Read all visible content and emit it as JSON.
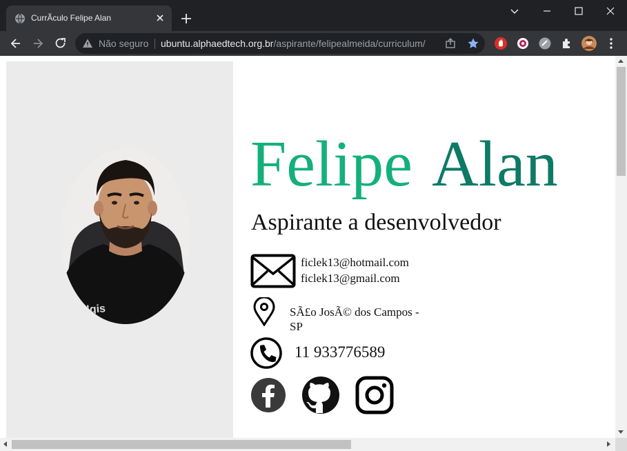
{
  "browser": {
    "tab_title": "CurrÃculo Felipe Alan",
    "security_label": "Não seguro",
    "url_host": "ubuntu.alphaedtech.org.br",
    "url_path": "/aspirante/felipealmeida/curriculum/"
  },
  "profile": {
    "first_name": "Felipe",
    "last_name": "Alan",
    "subtitle": "Aspirante a desenvolvedor",
    "email_1": "ficlek13@hotmail.com",
    "email_2": "ficlek13@gmail.com",
    "location": "SÃ£o JosÃ© dos Campos - SP",
    "phone": "11 933776589"
  },
  "colors": {
    "first_name": "#14b07c",
    "last_name": "#0d7a66",
    "sidebar_bg": "#ebebeb",
    "bookmark_star": "#8ab4f8"
  },
  "icons": [
    "globe-icon",
    "close-icon",
    "plus-icon",
    "chevron-down-icon",
    "minimize-icon",
    "maximize-icon",
    "back-icon",
    "forward-icon",
    "reload-icon",
    "warning-icon",
    "share-icon",
    "star-icon",
    "extension-stop-icon",
    "extension-record-icon",
    "extension-circle-icon",
    "puzzle-icon",
    "kebab-menu-icon",
    "envelope-icon",
    "location-pin-icon",
    "phone-icon",
    "facebook-icon",
    "github-icon",
    "instagram-icon"
  ]
}
